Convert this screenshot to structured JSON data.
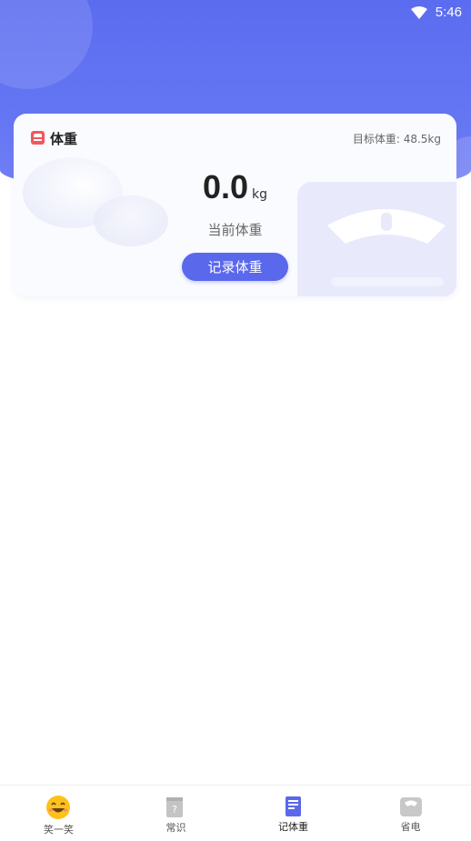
{
  "status_bar": {
    "time": "5:46"
  },
  "card": {
    "title": "体重",
    "goal": "目标体重: 48.5kg",
    "weight_value": "0.0",
    "weight_unit": "kg",
    "weight_label": "当前体重",
    "record_button": "记录体重"
  },
  "colors": {
    "accent": "#5a68ec",
    "header": "#5b6cf0",
    "icon_red": "#f2575b"
  },
  "nav": {
    "items": [
      {
        "label": "笑一笑",
        "icon": "smiley-icon",
        "active": false
      },
      {
        "label": "常识",
        "icon": "question-book-icon",
        "active": false
      },
      {
        "label": "记体重",
        "icon": "document-icon",
        "active": true
      },
      {
        "label": "省电",
        "icon": "scale-icon",
        "active": false
      }
    ]
  }
}
